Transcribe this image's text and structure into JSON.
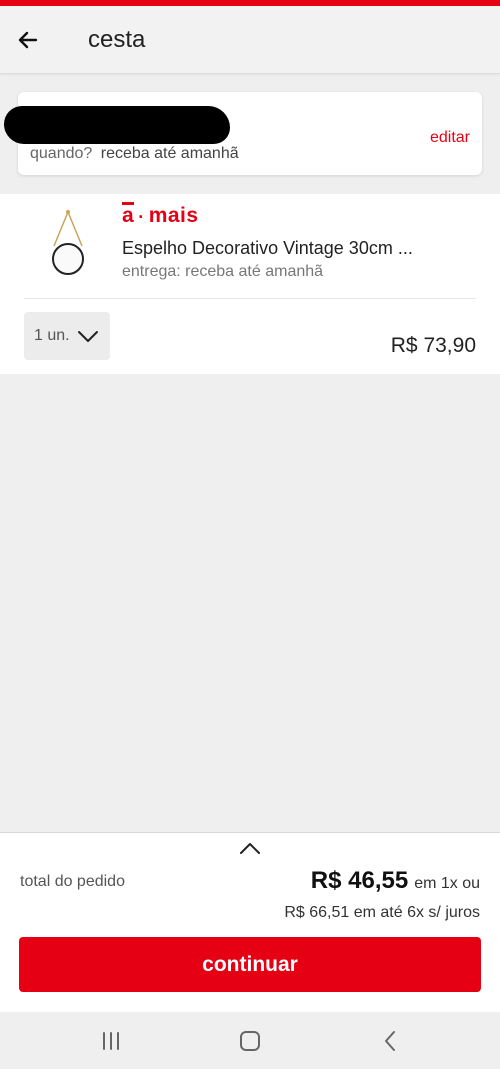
{
  "header": {
    "title": "cesta",
    "back_icon": "arrow-left-icon"
  },
  "delivery": {
    "when_label": "quando?",
    "when_value": "receba até amanhã",
    "edit_label": "editar"
  },
  "product": {
    "brand": {
      "a": "a",
      "dot": "·",
      "mais": "mais"
    },
    "name": "Espelho Decorativo Vintage 30cm ...",
    "delivery_info": "entrega: receba até amanhã",
    "quantity": "1 un.",
    "price": "R$ 73,90"
  },
  "footer": {
    "total_label": "total do pedido",
    "total_amount": "R$ 46,55",
    "total_suffix": "em 1x ou",
    "installments": "R$ 66,51 em até 6x s/ juros",
    "continue_label": "continuar"
  },
  "colors": {
    "accent": "#e60014",
    "background": "#efefef"
  }
}
